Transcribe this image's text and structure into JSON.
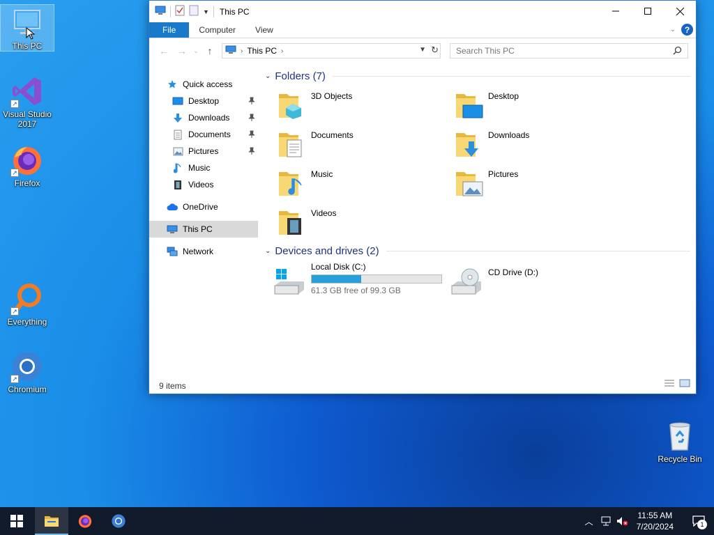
{
  "desktop": {
    "icons": [
      {
        "label": "This PC"
      },
      {
        "label": "Visual Studio 2017"
      },
      {
        "label": "Firefox"
      },
      {
        "label": "Everything"
      },
      {
        "label": "Chromium"
      },
      {
        "label": "Recycle Bin"
      }
    ]
  },
  "window": {
    "title": "This PC",
    "ribbon": {
      "file": "File",
      "computer": "Computer",
      "view": "View",
      "help": "?"
    },
    "address": {
      "location": "This PC"
    },
    "search": {
      "placeholder": "Search This PC"
    },
    "nav": {
      "quick_access": "Quick access",
      "items": [
        {
          "label": "Desktop",
          "pinned": true
        },
        {
          "label": "Downloads",
          "pinned": true
        },
        {
          "label": "Documents",
          "pinned": true
        },
        {
          "label": "Pictures",
          "pinned": true
        },
        {
          "label": "Music",
          "pinned": false
        },
        {
          "label": "Videos",
          "pinned": false
        }
      ],
      "onedrive": "OneDrive",
      "this_pc": "This PC",
      "network": "Network"
    },
    "folders": {
      "header": "Folders (7)",
      "items": [
        {
          "label": "3D Objects"
        },
        {
          "label": "Desktop"
        },
        {
          "label": "Documents"
        },
        {
          "label": "Downloads"
        },
        {
          "label": "Music"
        },
        {
          "label": "Pictures"
        },
        {
          "label": "Videos"
        }
      ]
    },
    "drives": {
      "header": "Devices and drives (2)",
      "items": [
        {
          "label": "Local Disk (C:)",
          "free_text": "61.3 GB free of 99.3 GB",
          "used_fraction": 0.383
        },
        {
          "label": "CD Drive (D:)"
        }
      ]
    },
    "status": {
      "items": "9 items"
    }
  },
  "taskbar": {
    "time": "11:55 AM",
    "date": "7/20/2024",
    "notification_count": "1"
  },
  "colors": {
    "accent": "#1979ca",
    "drive_bar": "#26a0da",
    "taskbar": "#101a2a"
  }
}
